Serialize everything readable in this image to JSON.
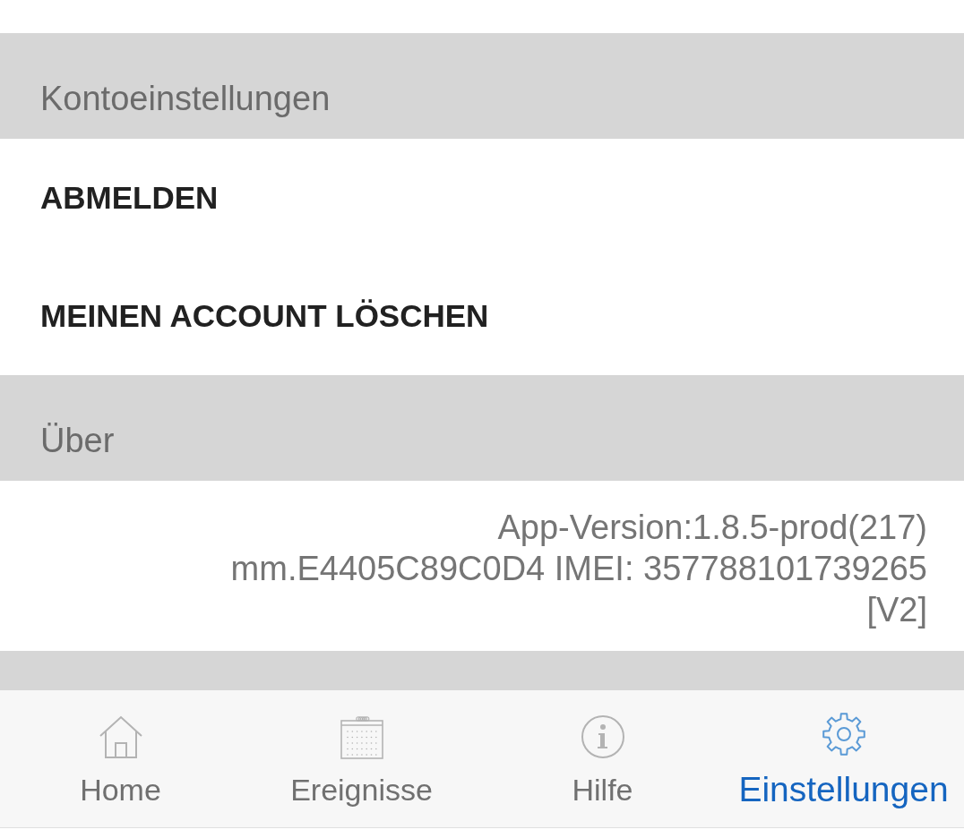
{
  "sections": [
    {
      "title": "Kontoeinstellungen",
      "kind": "actions",
      "items": [
        {
          "label": "ABMELDEN"
        },
        {
          "label": "MEINEN ACCOUNT LÖSCHEN"
        }
      ]
    },
    {
      "title": "Über",
      "kind": "info",
      "lines": [
        "App-Version:1.8.5-prod(217)",
        "mm.E4405C89C0D4 IMEI: 357788101739265",
        "[V2]"
      ]
    }
  ],
  "bottom_nav": [
    {
      "label": "Home",
      "selected": false
    },
    {
      "label": "Ereignisse",
      "selected": false
    },
    {
      "label": "Hilfe",
      "selected": false
    },
    {
      "label": "Einstellungen",
      "selected": true
    }
  ]
}
